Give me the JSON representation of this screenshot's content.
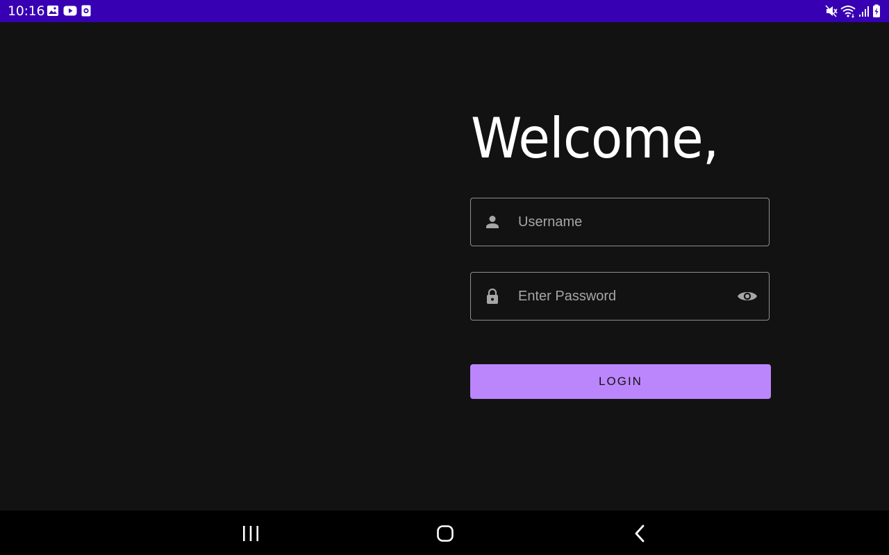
{
  "status_bar": {
    "time": "10:16",
    "left_icons": [
      "image-icon",
      "youtube-icon",
      "screen-record-icon"
    ],
    "right_icons": [
      "mute-icon",
      "wifi-icon",
      "signal-icon",
      "battery-charging-icon"
    ],
    "background_color": "#3700b3"
  },
  "login": {
    "title": "Welcome,",
    "username": {
      "placeholder": "Username",
      "icon": "person-icon"
    },
    "password": {
      "placeholder": "Enter Password",
      "icon": "lock-icon",
      "toggle_icon": "eye-icon"
    },
    "button_label": "LOGIN",
    "accent_color": "#bb86fc"
  },
  "nav_bar": {
    "buttons": [
      "recents-icon",
      "home-icon",
      "back-icon"
    ]
  }
}
